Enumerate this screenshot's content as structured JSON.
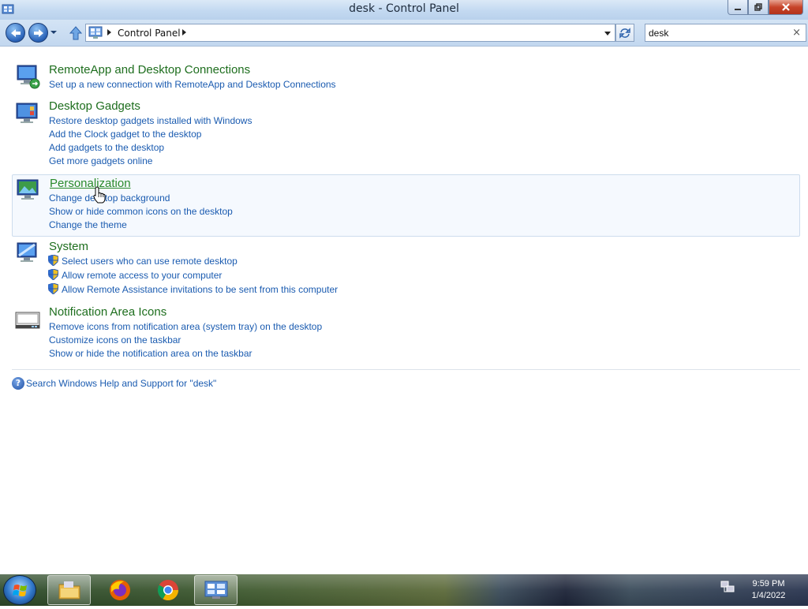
{
  "window": {
    "title": "desk - Control Panel"
  },
  "address": {
    "crumb": "Control Panel"
  },
  "search": {
    "value": "desk",
    "clear": "×"
  },
  "groups": [
    {
      "title": "RemoteApp and Desktop Connections",
      "icon": "remoteapp-icon",
      "links": [
        "Set up a new connection with RemoteApp and Desktop Connections"
      ]
    },
    {
      "title": "Desktop Gadgets",
      "icon": "gadgets-icon",
      "links": [
        "Restore desktop gadgets installed with Windows",
        "Add the Clock gadget to the desktop",
        "Add gadgets to the desktop",
        "Get more gadgets online"
      ]
    },
    {
      "title": "Personalization",
      "icon": "personalization-icon",
      "links": [
        "Change desktop background",
        "Show or hide common icons on the desktop",
        "Change the theme"
      ]
    },
    {
      "title": "System",
      "icon": "system-icon",
      "links": [
        "Select users who can use remote desktop",
        "Allow remote access to your computer",
        "Allow Remote Assistance invitations to be sent from this computer"
      ]
    },
    {
      "title": "Notification Area Icons",
      "icon": "notification-area-icon",
      "links": [
        "Remove icons from notification area (system tray) on the desktop",
        "Customize icons on the taskbar",
        "Show or hide the notification area on the taskbar"
      ]
    }
  ],
  "help": {
    "text": "Search Windows Help and Support for \"desk\"",
    "icon": "?"
  },
  "taskbar": {
    "items": [
      "start-button",
      "file-explorer-icon",
      "firefox-icon",
      "chrome-icon",
      "control-panel-icon"
    ],
    "clock": {
      "time": "9:59 PM",
      "date": "1/4/2022"
    }
  }
}
